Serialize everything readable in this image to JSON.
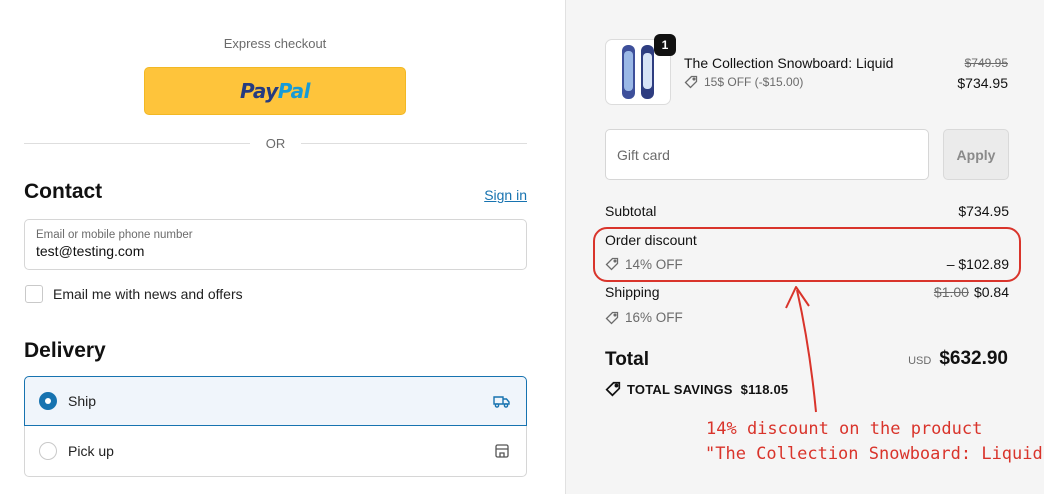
{
  "express": {
    "label": "Express checkout",
    "paypal_part1": "Pay",
    "paypal_part2": "Pal",
    "divider_text": "OR"
  },
  "contact": {
    "heading": "Contact",
    "signin_link": "Sign in",
    "email_label": "Email or mobile phone number",
    "email_value": "test@testing.com",
    "newsletter_label": "Email me with news and offers",
    "newsletter_checked": false
  },
  "delivery": {
    "heading": "Delivery",
    "options": [
      {
        "label": "Ship",
        "selected": true,
        "icon": "truck-icon"
      },
      {
        "label": "Pick up",
        "selected": false,
        "icon": "store-icon"
      }
    ]
  },
  "cart": {
    "item": {
      "quantity": "1",
      "name": "The Collection Snowboard: Liquid",
      "discount": "15$ OFF (-$15.00)",
      "original_price": "$749.95",
      "price": "$734.95"
    },
    "gift_card_placeholder": "Gift card",
    "apply_label": "Apply"
  },
  "summary": {
    "subtotal_label": "Subtotal",
    "subtotal_value": "$734.95",
    "order_discount_label": "Order discount",
    "order_discount_code": "14% OFF",
    "order_discount_value": "– $102.89",
    "shipping_label": "Shipping",
    "shipping_original": "$1.00",
    "shipping_value": "$0.84",
    "shipping_discount": "16% OFF",
    "total_label": "Total",
    "currency": "USD",
    "total_value": "$632.90",
    "savings_label": "TOTAL SAVINGS",
    "savings_value": "$118.05"
  },
  "annotation": {
    "line1": "14% discount on the product",
    "line2": "\"The Collection Snowboard: Liquid\"",
    "color": "#d9342b"
  },
  "colors": {
    "accent": "#1773b0",
    "paypal_yellow": "#fec43b",
    "summary_bg": "#f5f5f5"
  }
}
